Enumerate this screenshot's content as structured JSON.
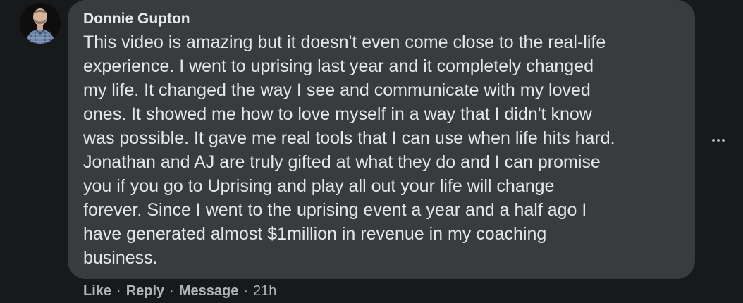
{
  "comment": {
    "author": "Donnie Gupton",
    "text": "This video is amazing but it doesn't even come close to the real-life experience. I went to uprising last year and it completely changed my life. It changed the way I see and communicate with my loved ones. It showed me how to love myself in a way that I didn't know was possible. It gave me real tools that I can use when life hits hard. Jonathan and AJ are truly gifted at what they do and I can promise you if you go to Uprising and play all out your life will change forever. Since I went to the uprising event a year and a half ago I have generated almost $1million in revenue in my coaching business.",
    "lines": [
      "This video is amazing but it doesn't even come close to the real-life",
      "experience. I went to uprising last year and it completely changed",
      "my life. It changed the way I see and communicate with my loved",
      "ones. It showed me how to love myself in a way that I didn't know",
      "was possible. It gave me real tools that I can use when life hits hard.",
      "Jonathan and AJ are truly gifted at what they do and I can promise",
      "you if you go to Uprising and play all out your life will change",
      "forever. Since I went to the uprising event a year and a half ago I",
      "have generated almost $1million in revenue in my coaching",
      "business."
    ]
  },
  "actions": {
    "like": "Like",
    "reply": "Reply",
    "message": "Message",
    "separator": "·",
    "timestamp": "21h"
  },
  "icons": {
    "avatar": "avatar-photo",
    "more": "more-options-icon"
  },
  "colors": {
    "background": "#18191a",
    "bubble": "#3a3b3c",
    "primary_text": "#e4e6eb",
    "secondary_text": "#b0b3b8"
  }
}
